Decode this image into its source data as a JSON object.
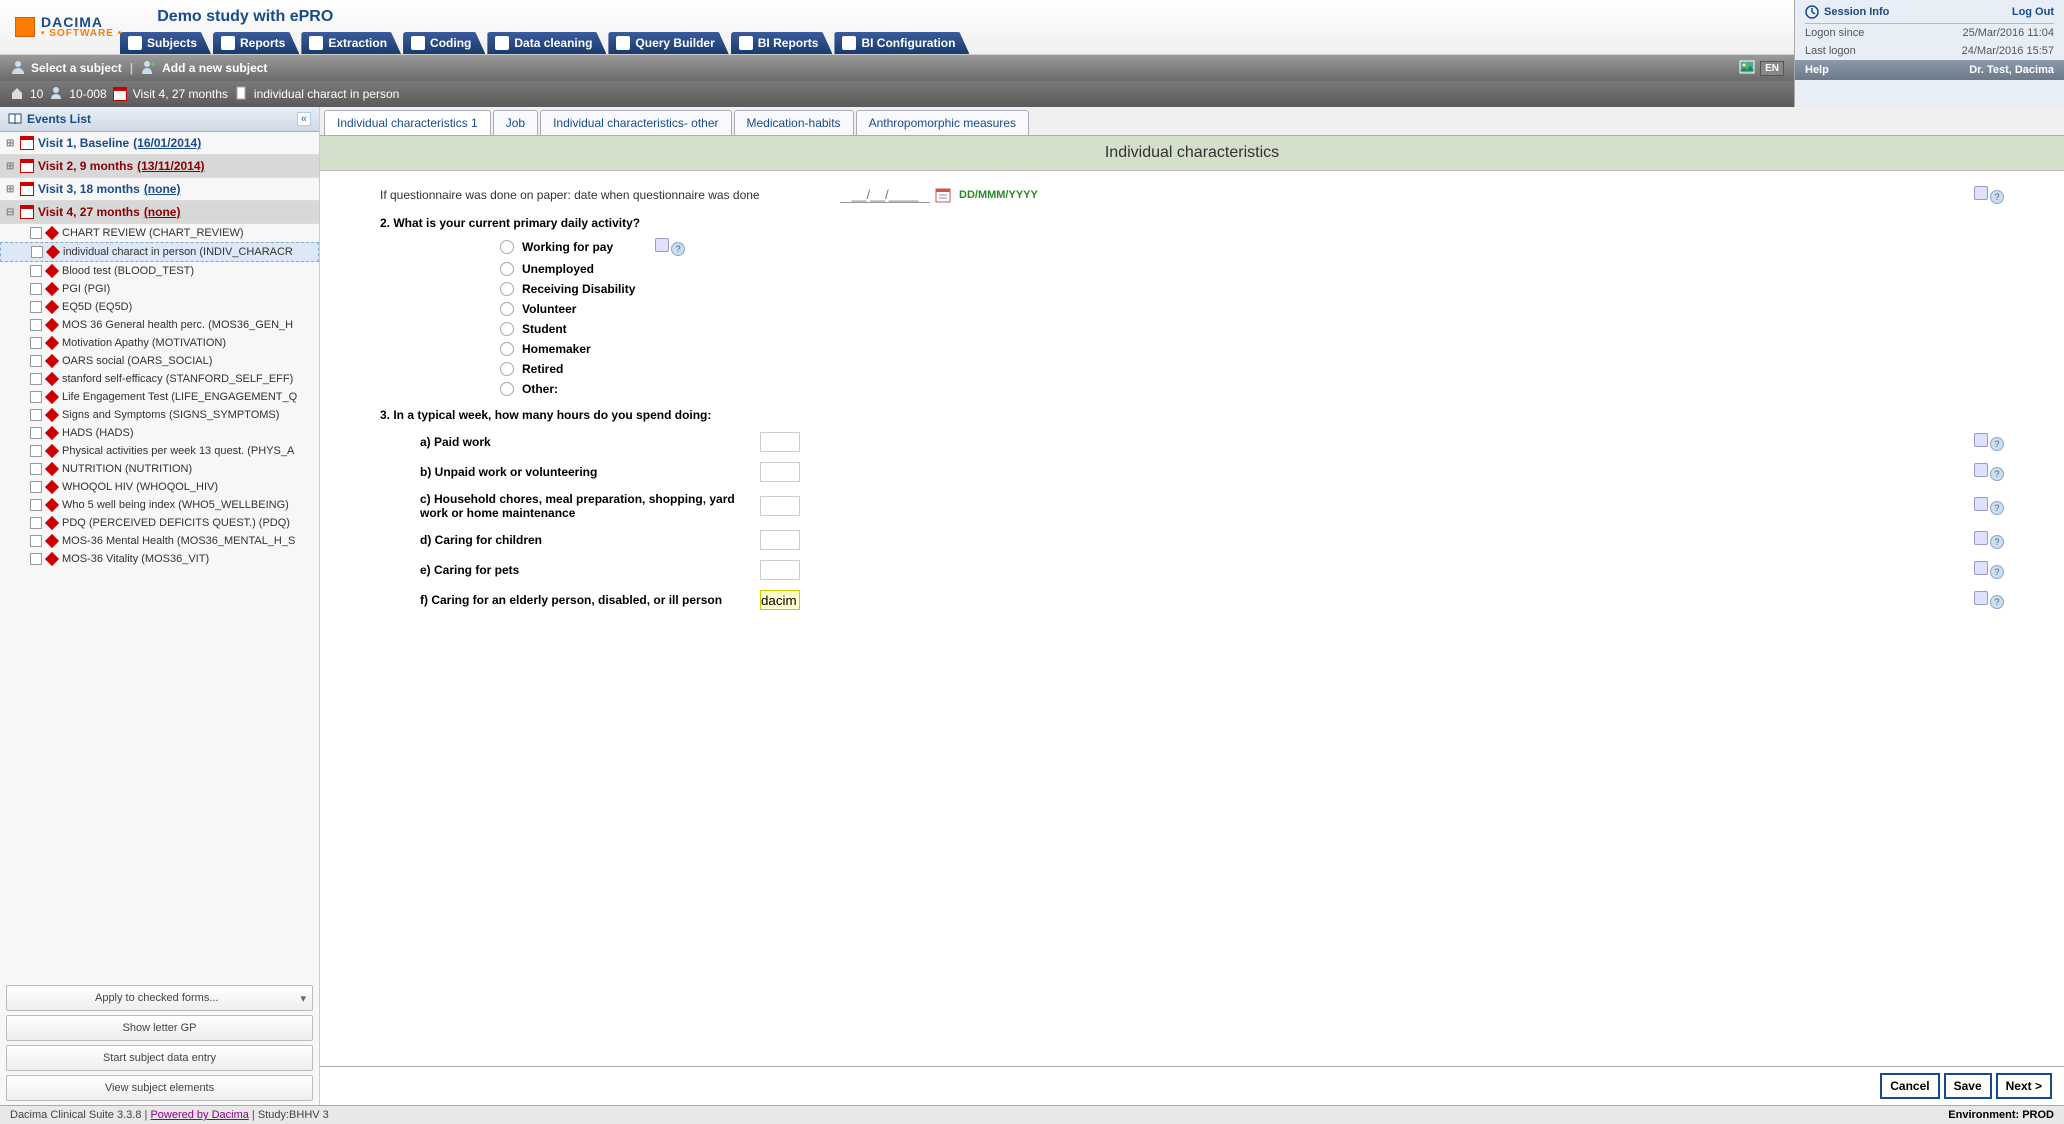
{
  "header": {
    "logo_top": "DACIMA",
    "logo_bottom": "• SOFTWARE •",
    "study_title": "Demo study with ePRO",
    "nav_tabs": [
      "Subjects",
      "Reports",
      "Extraction",
      "Coding",
      "Data cleaning",
      "Query Builder",
      "BI Reports",
      "BI Configuration"
    ]
  },
  "session": {
    "title": "Session Info",
    "logout": "Log Out",
    "rows": [
      {
        "k": "Logon since",
        "v": "25/Mar/2016 11:04"
      },
      {
        "k": "Last logon",
        "v": "24/Mar/2016 15:57"
      }
    ],
    "help": "Help",
    "user": "Dr. Test, Dacima"
  },
  "actionbar": {
    "select_subject": "Select a subject",
    "add_subject": "Add a new subject",
    "lang": "EN"
  },
  "breadcrumb": {
    "site": "10",
    "subject": "10-008",
    "visit": "Visit 4, 27 months",
    "form": "individual charact in person"
  },
  "sidebar": {
    "header": "Events List",
    "collapse": "«",
    "visits": [
      {
        "label": "Visit 1, Baseline",
        "date": "(16/01/2014)",
        "cls": "blue"
      },
      {
        "label": "Visit 2, 9 months",
        "date": "(13/11/2014)",
        "cls": "red"
      },
      {
        "label": "Visit 3, 18 months",
        "date": "(none)",
        "cls": "blue"
      },
      {
        "label": "Visit 4, 27 months",
        "date": "(none)",
        "cls": "red",
        "expanded": true
      }
    ],
    "forms": [
      "CHART REVIEW (CHART_REVIEW)",
      "individual charact in person (INDIV_CHARACR",
      "Blood test (BLOOD_TEST)",
      "PGI (PGI)",
      "EQ5D (EQ5D)",
      "MOS 36 General health perc. (MOS36_GEN_H",
      "Motivation Apathy (MOTIVATION)",
      "OARS social (OARS_SOCIAL)",
      "stanford self-efficacy (STANFORD_SELF_EFF)",
      "Life Engagement Test (LIFE_ENGAGEMENT_Q",
      "Signs and Symptoms (SIGNS_SYMPTOMS)",
      "HADS (HADS)",
      "Physical activities per week 13 quest. (PHYS_A",
      "NUTRITION (NUTRITION)",
      "WHOQOL HIV (WHOQOL_HIV)",
      "Who 5 well being index (WHO5_WELLBEING)",
      "PDQ (PERCEIVED DEFICITS QUEST.) (PDQ)",
      "MOS-36 Mental Health (MOS36_MENTAL_H_S",
      "MOS-36 Vitality (MOS36_VIT)"
    ],
    "active_form_index": 1,
    "buttons": [
      "Apply to checked forms...",
      "Show letter GP",
      "Start subject data entry",
      "View subject elements"
    ]
  },
  "content": {
    "tabs": [
      "Individual characteristics 1",
      "Job",
      "Individual characteristics- other",
      "Medication-habits",
      "Anthropomorphic measures"
    ],
    "active_tab": 0,
    "title": "Individual characteristics",
    "paper_q": "If questionnaire was done on paper: date when questionnaire was done",
    "date_placeholder": "__/__/____",
    "date_fmt": "DD/MMM/YYYY",
    "q2": "2. What is your current primary daily activity?",
    "q2_opts": [
      "Working for pay",
      "Unemployed",
      "Receiving Disability",
      "Volunteer",
      "Student",
      "Homemaker",
      "Retired",
      "Other:"
    ],
    "q3": "3. In a typical week, how many hours do you spend doing:",
    "q3_items": [
      {
        "lbl": "a) Paid work",
        "val": ""
      },
      {
        "lbl": "b) Unpaid work or volunteering",
        "val": ""
      },
      {
        "lbl": "c) Household chores, meal preparation, shopping, yard work or home maintenance",
        "val": ""
      },
      {
        "lbl": "d) Caring for children",
        "val": ""
      },
      {
        "lbl": "e) Caring for pets",
        "val": ""
      },
      {
        "lbl": "f) Caring for an elderly person, disabled, or ill person",
        "val": "dacim",
        "hl": true
      }
    ],
    "footer": {
      "cancel": "Cancel",
      "save": "Save",
      "next": "Next >"
    }
  },
  "status": {
    "version": "Dacima Clinical Suite 3.3.8",
    "powered": "Powered by Dacima",
    "study": "Study:BHHV 3",
    "env": "Environment: PROD"
  }
}
